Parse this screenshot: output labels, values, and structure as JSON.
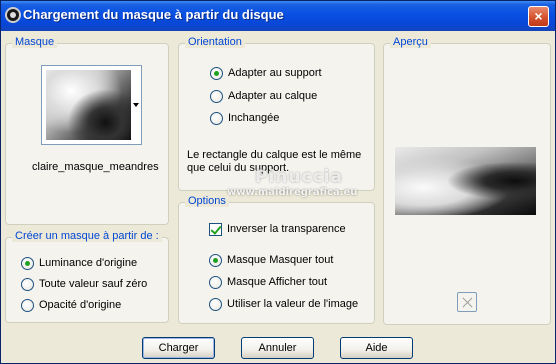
{
  "window": {
    "title": "Chargement du masque à partir du disque",
    "close_label": "×"
  },
  "masque": {
    "legend": "Masque",
    "mask_name": "claire_masque_meandres"
  },
  "orientation": {
    "legend": "Orientation",
    "options": [
      {
        "label": "Adapter au support",
        "checked": true
      },
      {
        "label": "Adapter au calque",
        "checked": false
      },
      {
        "label": "Inchangée",
        "checked": false
      }
    ],
    "description": "Le rectangle du calque est le même que celui du support."
  },
  "apercu": {
    "legend": "Aperçu"
  },
  "watermark": {
    "line1": "Pinuccia",
    "line2": "www.maidiregrafica.eu"
  },
  "creer": {
    "legend": "Créer un masque à partir de :",
    "options": [
      {
        "label": "Luminance d'origine",
        "checked": true
      },
      {
        "label": "Toute valeur sauf zéro",
        "checked": false
      },
      {
        "label": "Opacité d'origine",
        "checked": false
      }
    ]
  },
  "options": {
    "legend": "Options",
    "invert_label": "Inverser la transparence",
    "invert_checked": true,
    "radios": [
      {
        "label": "Masque Masquer tout",
        "checked": true
      },
      {
        "label": "Masque Afficher tout",
        "checked": false
      },
      {
        "label": "Utiliser la valeur de l'image",
        "checked": false
      }
    ]
  },
  "buttons": {
    "charger": "Charger",
    "annuler": "Annuler",
    "aide": "Aide"
  }
}
